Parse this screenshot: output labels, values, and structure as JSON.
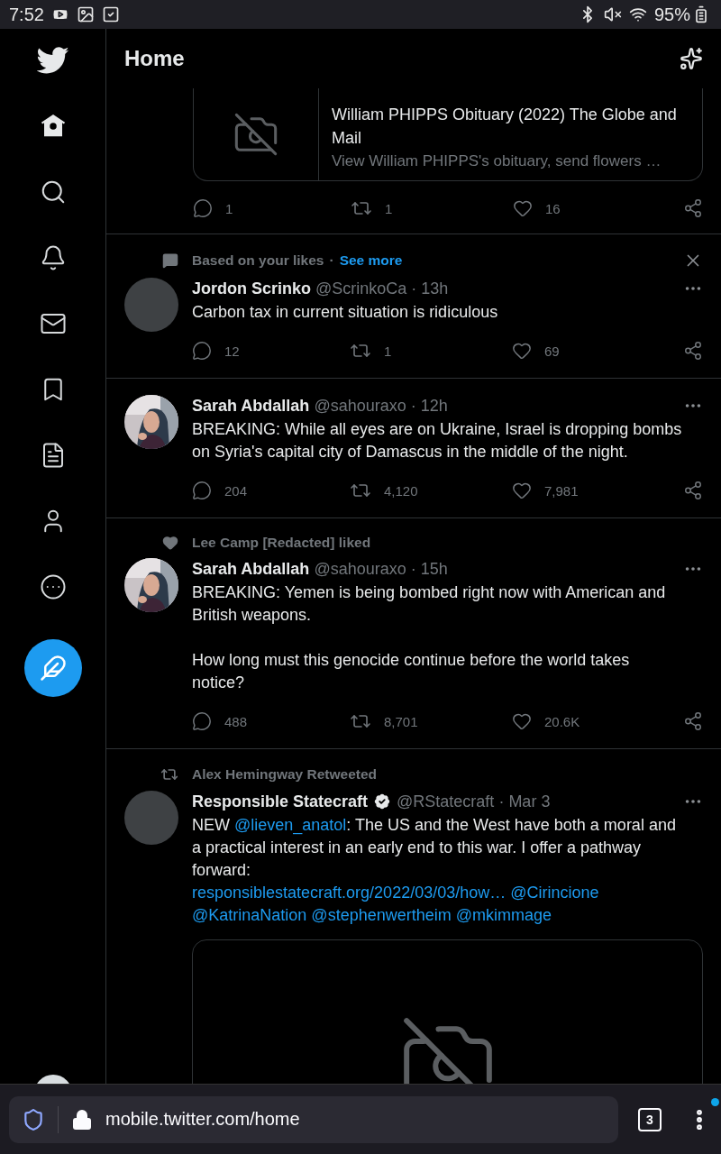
{
  "status_bar": {
    "time": "7:52",
    "battery": "95%"
  },
  "header": {
    "title": "Home"
  },
  "nav": [
    {
      "kind": "home",
      "selected": true
    },
    {
      "kind": "search",
      "selected": false
    },
    {
      "kind": "notifications",
      "selected": false
    },
    {
      "kind": "messages",
      "selected": false
    },
    {
      "kind": "bookmarks",
      "selected": false
    },
    {
      "kind": "lists",
      "selected": false
    },
    {
      "kind": "profile",
      "selected": false
    },
    {
      "kind": "more",
      "selected": false
    }
  ],
  "feed": [
    {
      "kind": "partial",
      "card": {
        "title": "William PHIPPS Obituary (2022) The Globe and Mail",
        "description": "View William PHIPPS's obituary, send flowers …"
      },
      "stats": {
        "replies": "1",
        "retweets": "1",
        "likes": "16"
      }
    },
    {
      "kind": "tweet",
      "context": {
        "kind": "suggested",
        "text": "Based on your likes",
        "dot": "·",
        "link": "See more"
      },
      "avatar": {
        "kind": "blank"
      },
      "name": "Jordon Scrinko",
      "verified": false,
      "handle": "@ScrinkoCa",
      "dot": "·",
      "time": "13h",
      "body": [
        {
          "kind": "text",
          "text": "Carbon tax in current situation is ridiculous"
        }
      ],
      "stats": {
        "replies": "12",
        "retweets": "1",
        "likes": "69"
      }
    },
    {
      "kind": "tweet",
      "avatar": {
        "kind": "picture"
      },
      "name": "Sarah Abdallah",
      "verified": false,
      "handle": "@sahouraxo",
      "dot": "·",
      "time": "12h",
      "body": [
        {
          "kind": "text",
          "text": "BREAKING: While all eyes are on Ukraine, Israel is dropping bombs on Syria's capital city of Damascus in the middle of the night."
        }
      ],
      "stats": {
        "replies": "204",
        "retweets": "4,120",
        "likes": "7,981"
      }
    },
    {
      "kind": "tweet",
      "context": {
        "kind": "liked",
        "text": "Lee Camp [Redacted] liked"
      },
      "avatar": {
        "kind": "picture"
      },
      "name": "Sarah Abdallah",
      "verified": false,
      "handle": "@sahouraxo",
      "dot": "·",
      "time": "15h",
      "body": [
        {
          "kind": "text",
          "text": "BREAKING: Yemen is being bombed right now with American and British weapons."
        },
        {
          "kind": "newline"
        },
        {
          "kind": "newline"
        },
        {
          "kind": "text",
          "text": "How long must this genocide continue before the world takes notice?"
        }
      ],
      "stats": {
        "replies": "488",
        "retweets": "8,701",
        "likes": "20.6K"
      }
    },
    {
      "kind": "tweet",
      "context": {
        "kind": "retweeted",
        "text": "Alex Hemingway Retweeted"
      },
      "avatar": {
        "kind": "blank"
      },
      "name": "Responsible Statecraft",
      "verified": true,
      "handle": "@RStatecraft",
      "dot": "·",
      "time": "Mar 3",
      "body": [
        {
          "kind": "text",
          "text": "NEW "
        },
        {
          "kind": "link",
          "text": "@lieven_anatol"
        },
        {
          "kind": "text",
          "text": ": The US and the West have both a moral and a practical interest in an early end to this war. I offer a pathway forward:"
        },
        {
          "kind": "newline"
        },
        {
          "kind": "link",
          "text": "responsiblestatecraft.org/2022/03/03/how…"
        },
        {
          "kind": "link",
          "text": "@Cirincione"
        },
        {
          "kind": "link",
          "text": "@KatrinaNation"
        },
        {
          "kind": "link",
          "text": "@stephenwertheim"
        },
        {
          "kind": "link",
          "text": "@mkimmage"
        }
      ],
      "media": {
        "kind": "broken-image"
      }
    }
  ],
  "browser": {
    "url": "mobile.twitter.com/home",
    "tab_count": "3",
    "menu_badge": true
  }
}
